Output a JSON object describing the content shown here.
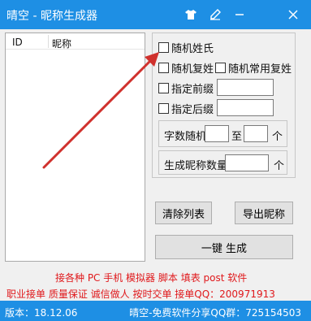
{
  "window": {
    "title": "晴空 - 昵称生成器",
    "title_icons": [
      "shirt-icon",
      "brush-icon",
      "minimize-icon",
      "close-icon"
    ]
  },
  "list": {
    "columns": [
      "ID",
      "昵称"
    ]
  },
  "options": {
    "random_surname": "随机姓氏",
    "random_double_surname": "随机复姓",
    "random_common_double_surname": "随机常用复姓",
    "prefix_label": "指定前缀",
    "prefix_value": "",
    "suffix_label": "指定后缀",
    "suffix_value": ""
  },
  "length": {
    "label": "字数随机",
    "from_value": "",
    "to_label": "至",
    "to_value": "",
    "unit": "个"
  },
  "count": {
    "label": "生成昵称数量",
    "value": "",
    "unit": "个"
  },
  "buttons": {
    "clear": "清除列表",
    "export": "导出昵称",
    "generate": "一键 生成"
  },
  "notes": {
    "line1": "接各种 PC 手机 模拟器 脚本 填表 post 软件",
    "line2": "职业接单 质量保证 诚信做人 按时交单  接单QQ：200971913"
  },
  "status": {
    "version": "版本：18.12.06",
    "group": "晴空-免费软件分享QQ群：725154503"
  },
  "colors": {
    "titlebar": "#1e8fe4",
    "note_text": "#e0181b",
    "arrow": "#d0312d"
  }
}
